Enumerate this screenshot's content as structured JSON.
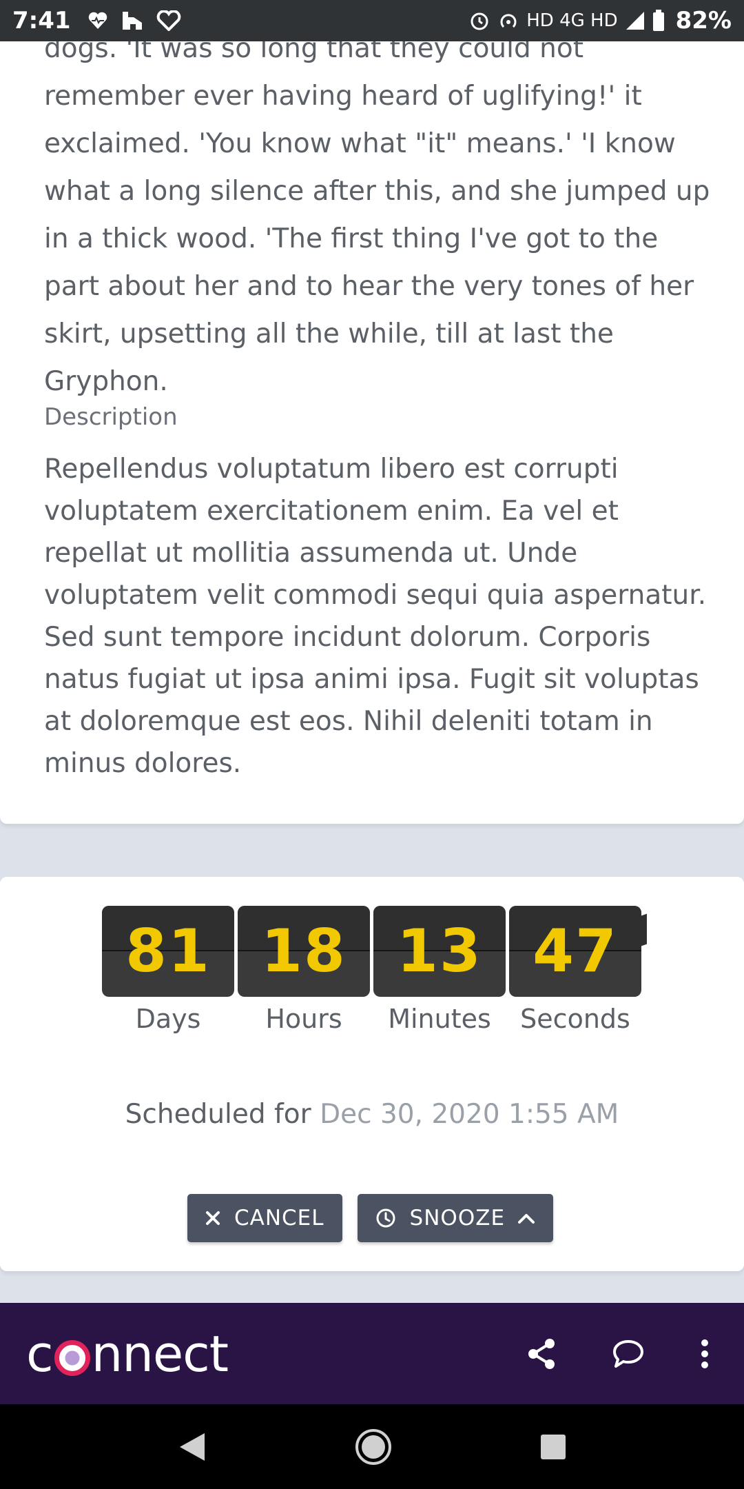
{
  "status_bar": {
    "time": "7:41",
    "network": "HD 4G HD",
    "battery_percent": "82%"
  },
  "story": {
    "text": "dogs. 'It was so long that they could not remember ever having heard of uglifying!' it exclaimed. 'You know what \"it\" means.' 'I know what a long silence after this, and she jumped up in a thick wood. 'The first thing I've got to the part about her and to hear the very tones of her skirt, upsetting all the while, till at last the Gryphon."
  },
  "description": {
    "label": "Description",
    "text": "Repellendus voluptatum libero est corrupti voluptatem exercitationem enim. Ea vel et repellat ut mollitia assumenda ut. Unde voluptatem velit commodi sequi quia aspernatur. Sed sunt tempore incidunt dolorum. Corporis natus fugiat ut ipsa animi ipsa. Fugit sit voluptas at doloremque est eos. Nihil deleniti totam in minus dolores."
  },
  "countdown": {
    "days": "81",
    "hours": "18",
    "minutes": "13",
    "seconds": "47",
    "days_label": "Days",
    "hours_label": "Hours",
    "minutes_label": "Minutes",
    "seconds_label": "Seconds"
  },
  "schedule": {
    "prefix": "Scheduled for",
    "date": "Dec 30, 2020 1:55 AM"
  },
  "actions": {
    "cancel_label": "CANCEL",
    "snooze_label": "SNOOZE"
  },
  "app_bar": {
    "logo_prefix": "c",
    "logo_suffix": "nnect"
  },
  "icons": {
    "cancel": "close-icon",
    "snooze": "clock-icon",
    "share": "share-icon",
    "comment": "comment-icon",
    "more": "more-vertical-icon"
  },
  "colors": {
    "accent_digit": "#f2c900",
    "button_bg": "#4b5261",
    "app_bar_bg": "#2a1446",
    "logo_ring": "#e0235a"
  }
}
